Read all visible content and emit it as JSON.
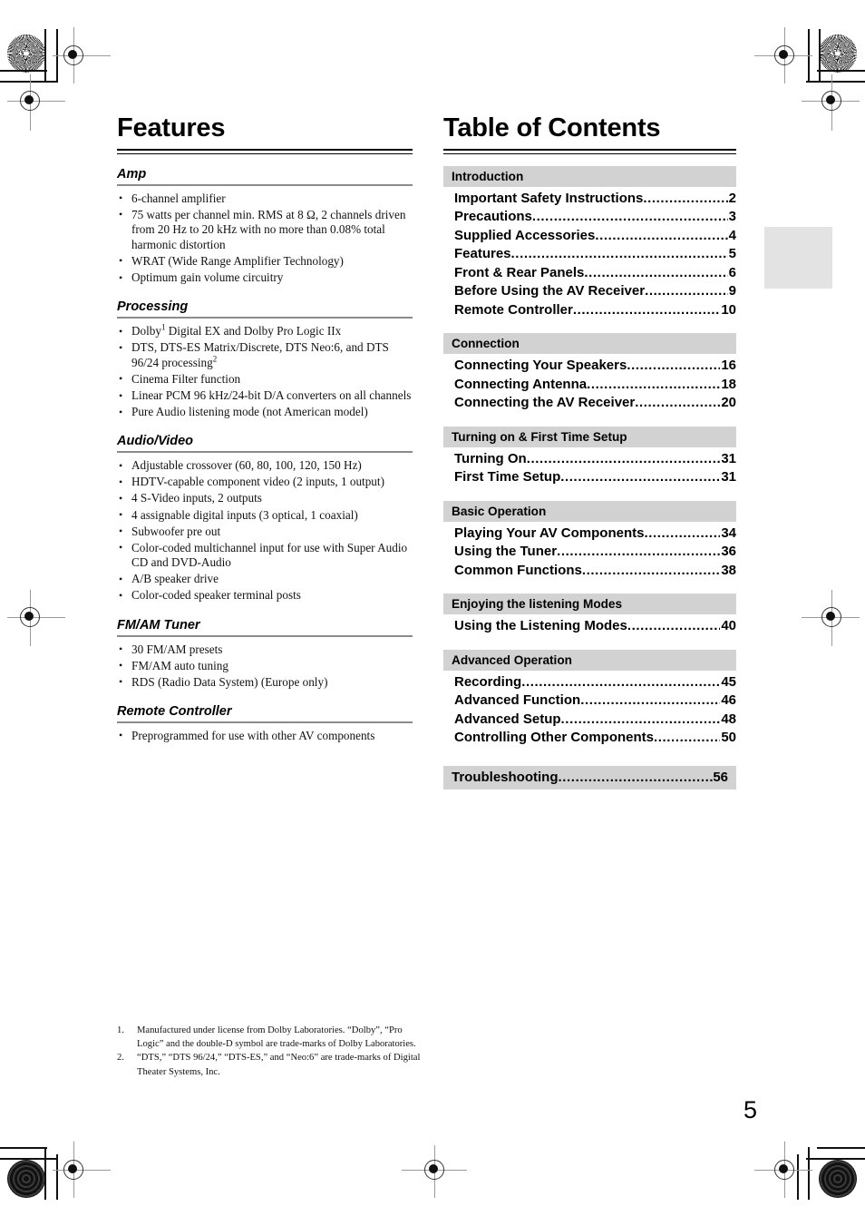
{
  "page_number": "5",
  "left_column": {
    "title": "Features",
    "sections": [
      {
        "heading": "Amp",
        "items": [
          {
            "text": "6-channel amplifier"
          },
          {
            "text": "75 watts per channel min. RMS at 8 Ω, 2 channels driven from 20 Hz to 20 kHz with no more than 0.08% total harmonic distortion"
          },
          {
            "text": "WRAT (Wide Range Amplifier Technology)"
          },
          {
            "text": "Optimum gain volume circuitry"
          }
        ]
      },
      {
        "heading": "Processing",
        "items": [
          {
            "text": "Dolby",
            "sup": "1",
            "text2": " Digital EX and Dolby Pro Logic IIx"
          },
          {
            "text": "DTS, DTS-ES Matrix/Discrete, DTS Neo:6, and DTS 96/24 processing",
            "sup": "2",
            "text2": ""
          },
          {
            "text": "Cinema Filter function"
          },
          {
            "text": "Linear PCM 96 kHz/24-bit D/A converters on all channels"
          },
          {
            "text": "Pure Audio listening mode (not American model)"
          }
        ]
      },
      {
        "heading": "Audio/Video",
        "items": [
          {
            "text": "Adjustable crossover (60, 80, 100, 120, 150 Hz)"
          },
          {
            "text": "HDTV-capable component video (2 inputs, 1 output)"
          },
          {
            "text": "4 S-Video inputs, 2 outputs"
          },
          {
            "text": "4 assignable digital inputs (3 optical, 1 coaxial)"
          },
          {
            "text": "Subwoofer pre out"
          },
          {
            "text": "Color-coded multichannel input for use with Super Audio CD and DVD-Audio"
          },
          {
            "text": "A/B speaker drive"
          },
          {
            "text": "Color-coded speaker terminal posts"
          }
        ]
      },
      {
        "heading": "FM/AM Tuner",
        "items": [
          {
            "text": "30 FM/AM presets"
          },
          {
            "text": "FM/AM auto tuning"
          },
          {
            "text": "RDS (Radio Data System) (Europe only)"
          }
        ]
      },
      {
        "heading": "Remote Controller",
        "items": [
          {
            "text": "Preprogrammed for use with other AV components"
          }
        ]
      }
    ]
  },
  "right_column": {
    "title": "Table of Contents",
    "sections": [
      {
        "band": "Introduction",
        "entries": [
          {
            "label": "Important Safety Instructions",
            "page": "2"
          },
          {
            "label": "Precautions",
            "page": "3"
          },
          {
            "label": "Supplied Accessories",
            "page": "4"
          },
          {
            "label": "Features",
            "page": "5"
          },
          {
            "label": "Front & Rear Panels",
            "page": "6"
          },
          {
            "label": "Before Using the AV Receiver",
            "page": "9"
          },
          {
            "label": "Remote Controller",
            "page": "10"
          }
        ]
      },
      {
        "band": "Connection",
        "entries": [
          {
            "label": "Connecting Your Speakers",
            "page": "16"
          },
          {
            "label": "Connecting Antenna",
            "page": "18"
          },
          {
            "label": "Connecting the AV Receiver",
            "page": "20"
          }
        ]
      },
      {
        "band": "Turning on & First Time Setup",
        "entries": [
          {
            "label": "Turning On",
            "page": "31"
          },
          {
            "label": "First Time Setup",
            "page": "31"
          }
        ]
      },
      {
        "band": "Basic Operation",
        "entries": [
          {
            "label": "Playing Your AV Components",
            "page": "34"
          },
          {
            "label": "Using the Tuner",
            "page": "36"
          },
          {
            "label": "Common Functions",
            "page": "38"
          }
        ]
      },
      {
        "band": "Enjoying the listening Modes",
        "entries": [
          {
            "label": "Using the Listening Modes",
            "page": "40"
          }
        ]
      },
      {
        "band": "Advanced Operation",
        "entries": [
          {
            "label": "Recording",
            "page": "45"
          },
          {
            "label": "Advanced Function",
            "page": "46"
          },
          {
            "label": "Advanced Setup",
            "page": "48"
          },
          {
            "label": "Controlling Other Components",
            "page": "50"
          }
        ]
      }
    ],
    "final_band": {
      "label": "Troubleshooting",
      "page": "56"
    }
  },
  "footnotes": [
    {
      "num": "1.",
      "text": "Manufactured under license from Dolby Laboratories. “Dolby”, “Pro Logic” and the double-D symbol are trade-marks of Dolby Laboratories."
    },
    {
      "num": "2.",
      "text": "“DTS,” “DTS 96/24,” “DTS-ES,” and “Neo:6” are trade-marks of Digital Theater Systems, Inc."
    }
  ],
  "colors": {
    "band_gray": "#d2d2d2",
    "thumb_tab_gray": "#e3e3e3",
    "rule_gray": "#8b8b8b"
  }
}
